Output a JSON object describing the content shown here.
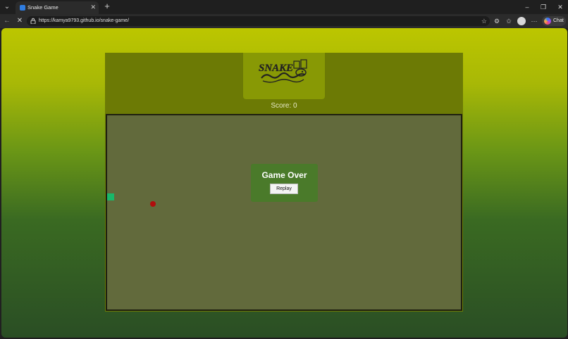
{
  "browser": {
    "tab": {
      "title": "Snake Game",
      "close_glyph": "✕"
    },
    "new_tab_glyph": "+",
    "tab_menu_glyph": "⌄",
    "window_controls": {
      "minimize": "–",
      "restore": "❐",
      "close": "✕"
    },
    "nav": {
      "back": "←",
      "stop": "✕"
    },
    "url": "https://kamya9793.github.io/snake-game/",
    "star_glyph": "☆",
    "tools": {
      "extensions": "⚙",
      "favorites": "✩",
      "menu": "···"
    },
    "chat_label": "Chat",
    "colors": {
      "chrome": "#1f1f1f",
      "toolbar": "#2b2b2b"
    }
  },
  "game": {
    "logo_text": "SNAKE",
    "score_label": "Score: 0",
    "game_over": {
      "title": "Game Over",
      "replay_label": "Replay"
    },
    "colors": {
      "snake": "#19b86a",
      "food": "#b00d0d",
      "board": "#626a3c",
      "overlay": "#4a7a2a"
    }
  }
}
